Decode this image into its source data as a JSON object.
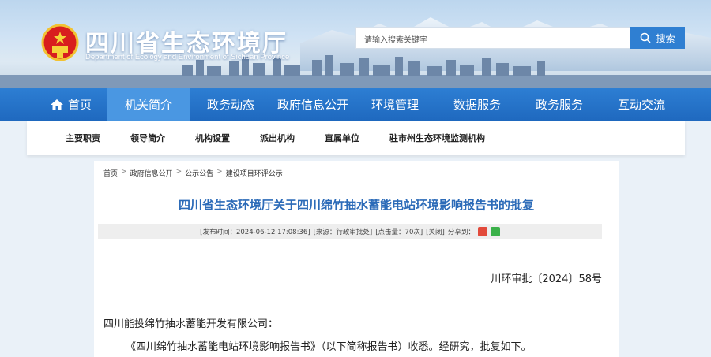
{
  "header": {
    "title": "四川省生态环境厅",
    "subtitle": "Department of Ecology and Environment of Sichuan Province",
    "emblem_icon": "national-emblem-icon",
    "search": {
      "placeholder": "请输入搜索关键字",
      "button_label": "搜索",
      "icon": "search-icon"
    }
  },
  "mainnav": {
    "items": [
      {
        "label": "首页",
        "icon": "home-icon"
      },
      {
        "label": "机关简介",
        "active": true
      },
      {
        "label": "政务动态"
      },
      {
        "label": "政府信息公开"
      },
      {
        "label": "环境管理"
      },
      {
        "label": "数据服务"
      },
      {
        "label": "政务服务"
      },
      {
        "label": "互动交流"
      }
    ]
  },
  "subnav": {
    "items": [
      {
        "label": "主要职责"
      },
      {
        "label": "领导简介"
      },
      {
        "label": "机构设置"
      },
      {
        "label": "派出机构"
      },
      {
        "label": "直属单位"
      },
      {
        "label": "驻市州生态环境监测机构"
      }
    ]
  },
  "breadcrumb": [
    "首页",
    "政府信息公开",
    "公示公告",
    "建设项目环评公示"
  ],
  "breadcrumb_separator": ">",
  "article": {
    "title": "四川省生态环境厅关于四川绵竹抽水蓄能电站环境影响报告书的批复",
    "meta": {
      "published": "[发布时间：2024-06-12 17:08:36]",
      "source": "[来源：行政审批处]",
      "views": "[点击量：70次]",
      "close": "[关闭]",
      "share_label": "分享到：",
      "share_icons": [
        "weibo-icon",
        "wechat-icon"
      ]
    },
    "doc_number": "川环审批〔2024〕58号",
    "recipient": "四川能投绵竹抽水蓄能开发有限公司：",
    "paragraph": "《四川绵竹抽水蓄能电站环境影响报告书》（以下简称报告书）收悉。经研究，批复如下。"
  },
  "colors": {
    "nav_blue": "#1f69bf",
    "nav_active": "#4a97e2",
    "title_blue": "#2c6bb8",
    "search_button": "#2f7fd2"
  }
}
